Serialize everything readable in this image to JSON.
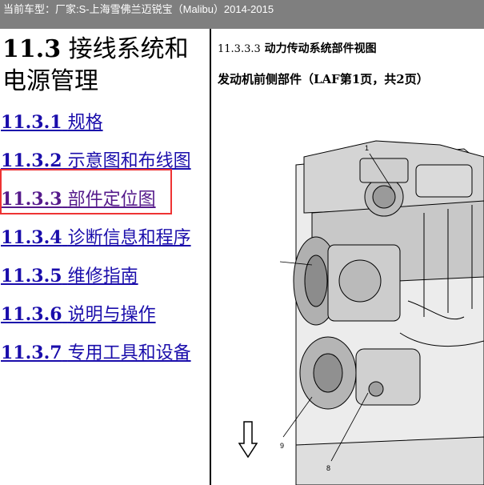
{
  "topbar": {
    "label": "当前车型：",
    "vehicle": "厂家:S-上海雪佛兰迈锐宝（Malibu）2014-2015"
  },
  "section": {
    "number": "11.3",
    "title": "接线系统和电源管理"
  },
  "nav": [
    {
      "number": "11.3.1",
      "label": "规格"
    },
    {
      "number": "11.3.2",
      "label": "示意图和布线图"
    },
    {
      "number": "11.3.3",
      "label": "部件定位图"
    },
    {
      "number": "11.3.4",
      "label": "诊断信息和程序"
    },
    {
      "number": "11.3.5",
      "label": "维修指南"
    },
    {
      "number": "11.3.6",
      "label": "说明与操作"
    },
    {
      "number": "11.3.7",
      "label": "专用工具和设备"
    }
  ],
  "content": {
    "subsection_number": "11.3.3.3",
    "subsection_title": "动力传动系统部件视图",
    "view_title": "发动机前侧部件（LAF第1页，共2页）",
    "callouts": [
      "1",
      "10",
      "9",
      "8"
    ],
    "arrow_icon": "down-arrow-icon"
  },
  "colors": {
    "topbar_bg": "#7f7f7f",
    "link": "#1a0dab",
    "visited_link": "#551a8b",
    "highlight_border": "#ee3333"
  }
}
